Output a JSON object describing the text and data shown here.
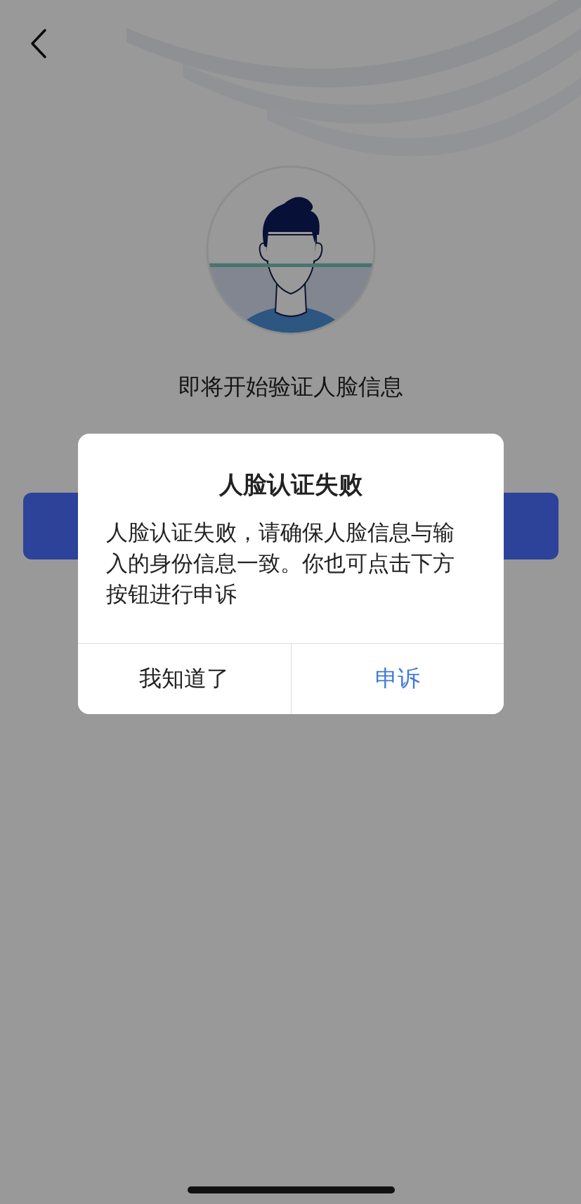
{
  "page": {
    "title": "即将开始验证人脸信息"
  },
  "dialog": {
    "title": "人脸认证失败",
    "message": "人脸认证失败，请确保人脸信息与输入的身份信息一致。你也可点击下方按钮进行申诉",
    "buttons": [
      {
        "label": "我知道了",
        "kind": "secondary"
      },
      {
        "label": "申诉",
        "kind": "primary"
      }
    ]
  }
}
